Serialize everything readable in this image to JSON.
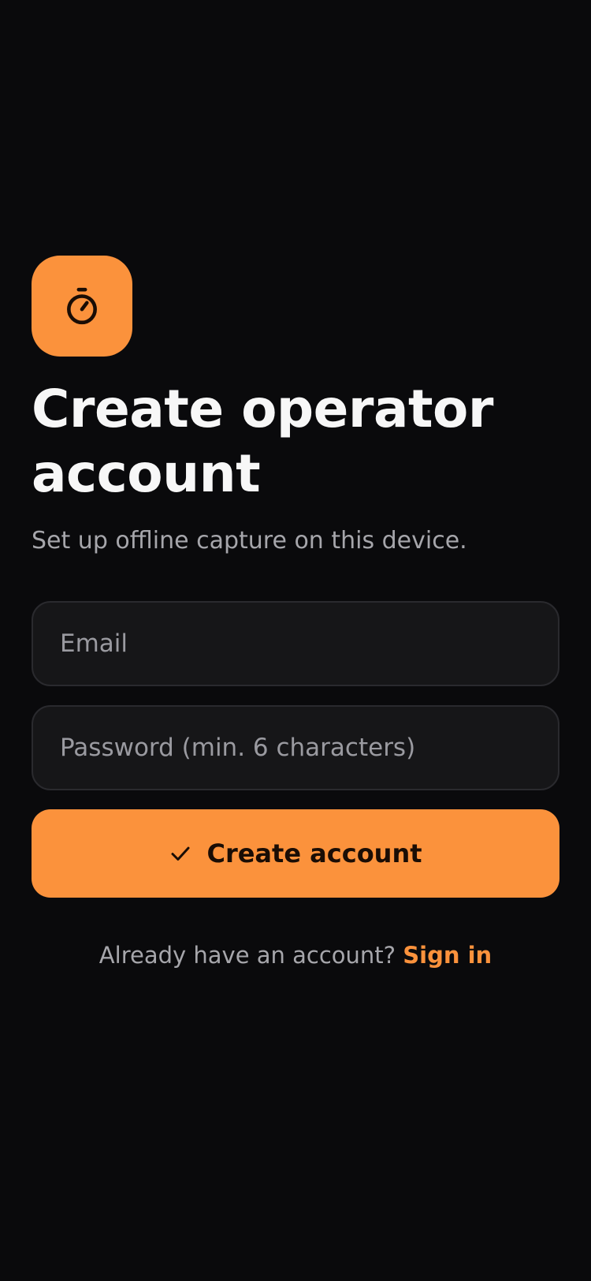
{
  "app_icon": {
    "name": "stopwatch-icon",
    "color": "#fb923c"
  },
  "header": {
    "title_line1": "Create operator",
    "title_line2": "account",
    "subtitle": "Set up offline capture on this device."
  },
  "form": {
    "email_placeholder": "Email",
    "email_value": "",
    "password_placeholder": "Password (min. 6 characters)",
    "password_value": "",
    "submit_label": "Create account",
    "submit_icon": "check-icon"
  },
  "footer": {
    "prompt": "Already have an account?",
    "link_label": "Sign in"
  },
  "colors": {
    "background": "#0a0a0c",
    "accent": "#fb923c",
    "field_background": "#161618",
    "muted_text": "#a6a6ab"
  }
}
